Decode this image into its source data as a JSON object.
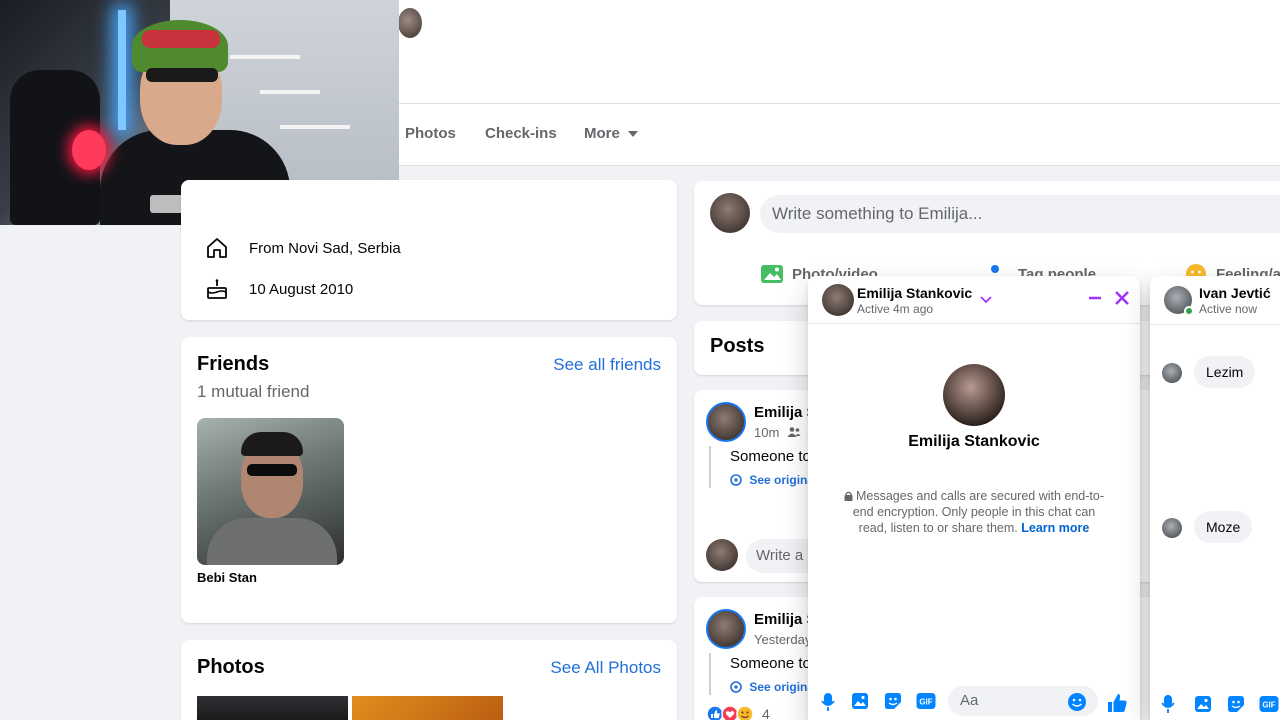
{
  "nav": {
    "tabs": [
      "Photos",
      "Check-ins",
      "More"
    ]
  },
  "intro": {
    "from": "From Novi Sad, Serbia",
    "birthday": "10 August 2010"
  },
  "friends": {
    "title": "Friends",
    "see_all": "See all friends",
    "mutual": "1 mutual friend",
    "items": [
      {
        "name": "Bebi Stan"
      }
    ]
  },
  "photos": {
    "title": "Photos",
    "see_all": "See All Photos"
  },
  "composer": {
    "placeholder": "Write something to Emilija...",
    "actions": [
      "Photo/video",
      "Tag people",
      "Feeling/a"
    ]
  },
  "posts": {
    "title": "Posts",
    "items": [
      {
        "author": "Emilija S",
        "time": "10m",
        "text": "Someone to",
        "see_original": "See origina",
        "comment_placeholder": "Write a"
      },
      {
        "author": "Emilija S",
        "time": "Yesterday",
        "text": "Someone to",
        "see_original": "See origina",
        "reaction_count": "4"
      }
    ]
  },
  "chat": {
    "name": "Emilija Stankovic",
    "status": "Active 4m ago",
    "profile_name": "Emilija Stankovic",
    "notice": "Messages and calls are secured with end-to-end encryption. Only people in this chat can read, listen to or share them.",
    "learn_more": "Learn more",
    "input_placeholder": "Aa",
    "accent": "#a033ff"
  },
  "chat2": {
    "name": "Ivan Jevtić",
    "status": "Active now",
    "messages": [
      "Lezim",
      "Moze"
    ]
  },
  "colors": {
    "link": "#216fdb",
    "messenger_blue": "#0084ff",
    "online_green": "#31a24c"
  }
}
